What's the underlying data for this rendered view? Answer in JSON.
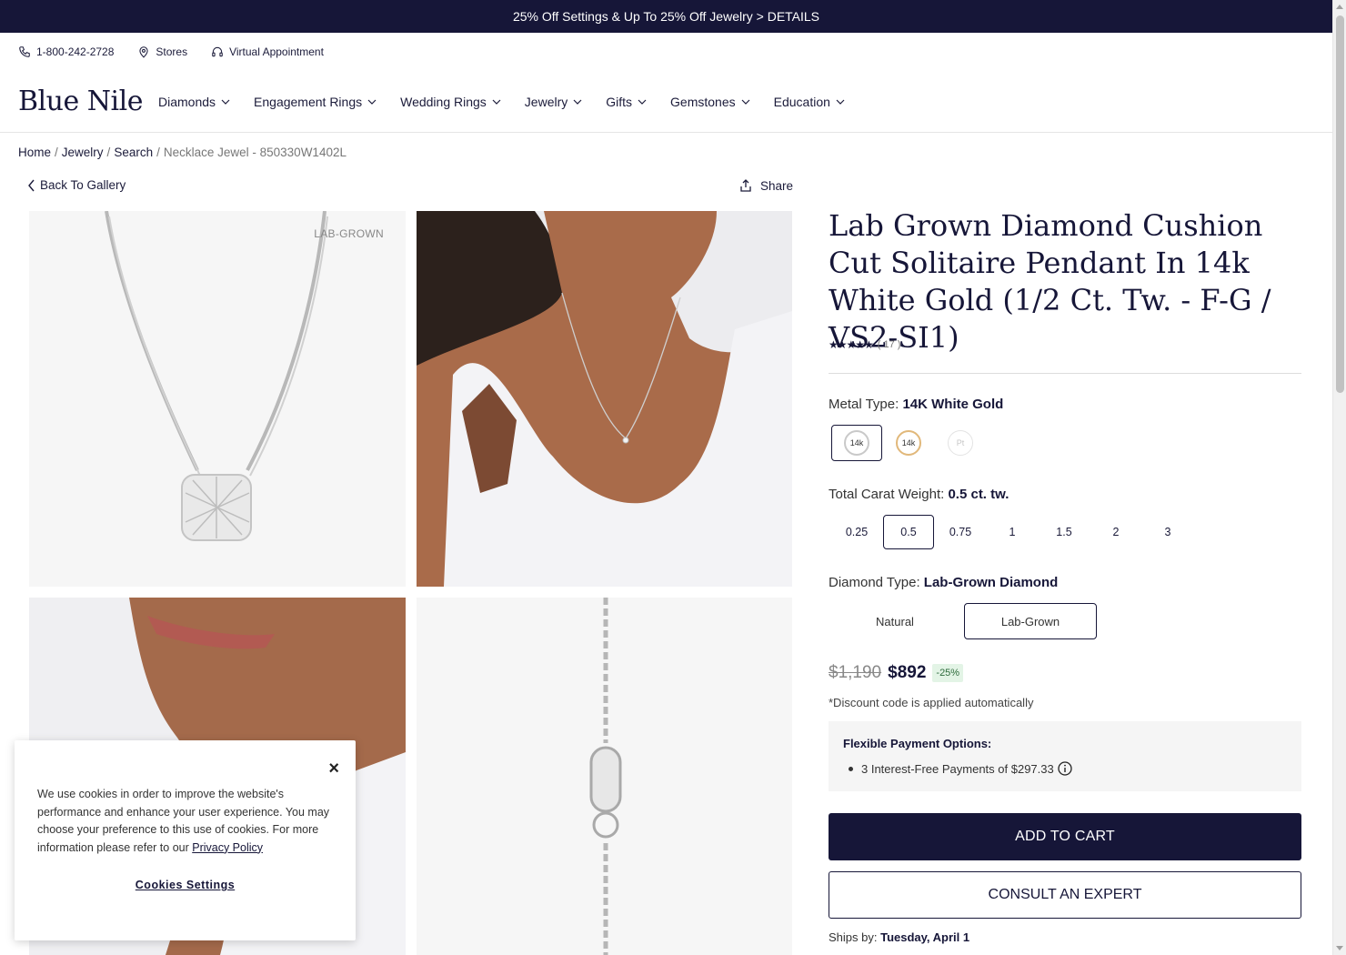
{
  "promo": {
    "text": "25% Off Settings & Up To 25% Off Jewelry > DETAILS"
  },
  "utility": {
    "phone": "1-800-242-2728",
    "stores": "Stores",
    "appointment": "Virtual Appointment"
  },
  "brand": {
    "logo": "Blue Nile"
  },
  "nav": [
    "Diamonds",
    "Engagement Rings",
    "Wedding Rings",
    "Jewelry",
    "Gifts",
    "Gemstones",
    "Education"
  ],
  "breadcrumb": {
    "home": "Home",
    "jewelry": "Jewelry",
    "search": "Search",
    "current": "Necklace Jewel - 850330W1402L",
    "separator": "/"
  },
  "actions": {
    "back": "Back To Gallery",
    "share": "Share"
  },
  "gallery": {
    "tag": "LAB-GROWN"
  },
  "product": {
    "title": "Lab Grown Diamond Cushion Cut Solitaire Pendant In 14k White Gold (1/2 Ct. Tw. - F-G / VS2-SI1)",
    "rating_stars": "★★★★★",
    "rating_value": 4.5,
    "review_count": "( 17 )"
  },
  "metal": {
    "label": "Metal Type:",
    "value": "14K White Gold",
    "options": [
      "14k",
      "14k",
      "Pt"
    ]
  },
  "carat": {
    "label": "Total Carat Weight:",
    "value": "0.5 ct. tw.",
    "options": [
      "0.25",
      "0.5",
      "0.75",
      "1",
      "1.5",
      "2",
      "3"
    ]
  },
  "diamond_type": {
    "label": "Diamond Type:",
    "value": "Lab-Grown Diamond",
    "options": [
      "Natural",
      "Lab-Grown"
    ]
  },
  "price": {
    "original": "$1,190",
    "current": "$892",
    "badge": "-25%",
    "note": "*Discount code is applied automatically"
  },
  "payment": {
    "title": "Flexible Payment Options:",
    "item": "3 Interest-Free Payments of $297.33"
  },
  "buttons": {
    "add_to_cart": "ADD TO CART",
    "consult": "CONSULT AN EXPERT"
  },
  "shipping": {
    "label": "Ships by:",
    "date": "Tuesday, April 1"
  },
  "cookie": {
    "close": "×",
    "text": "We use cookies in order to improve the website's performance and enhance your user experience. You may choose your preference to this use of cookies. For more information please refer to our ",
    "link": "Privacy Policy",
    "settings": "Cookies Settings"
  },
  "colors": {
    "navy": "#161638",
    "badge_bg": "#e3f4e6",
    "badge_text": "#2f6c3d",
    "yellow_gold": "#e1b87a"
  }
}
